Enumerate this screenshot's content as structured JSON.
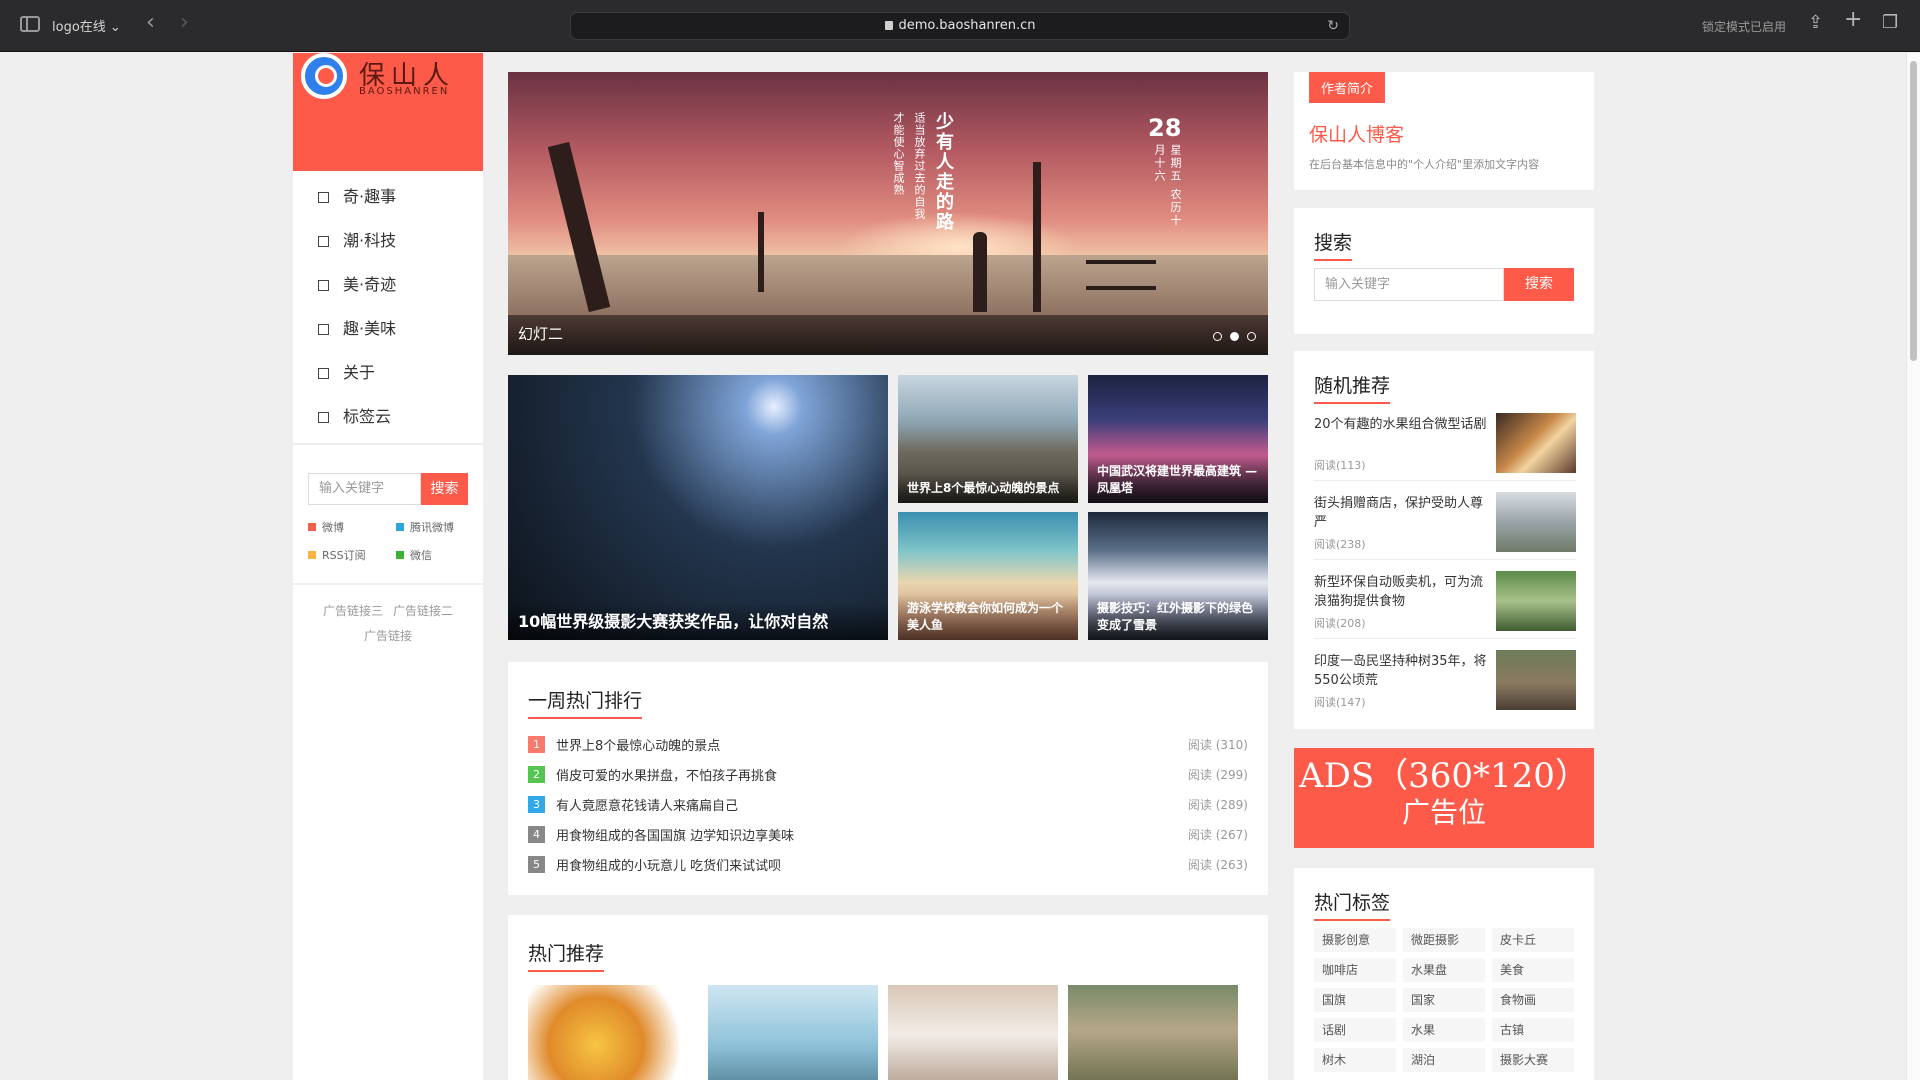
{
  "browser": {
    "tab_group": "logo在线",
    "url": "demo.baoshanren.cn",
    "lock_mode": "锁定模式已启用"
  },
  "logo": {
    "chars": "保山人",
    "en": "BAOSHANREN"
  },
  "leftnav": [
    {
      "label": "奇·趣事"
    },
    {
      "label": "潮·科技"
    },
    {
      "label": "美·奇迹"
    },
    {
      "label": "趣·美味"
    },
    {
      "label": "关于"
    },
    {
      "label": "标签云"
    }
  ],
  "left_search": {
    "placeholder": "输入关键字",
    "button": "搜索"
  },
  "social": [
    {
      "label": "微博",
      "color": "#f0624d"
    },
    {
      "label": "腾讯微博",
      "color": "#2ea7e0"
    },
    {
      "label": "RSS订阅",
      "color": "#f7b240"
    },
    {
      "label": "微信",
      "color": "#3cb034"
    }
  ],
  "left_ads": [
    "广告链接三",
    "广告链接二",
    "广告链接"
  ],
  "slider": {
    "caption": "幻灯二",
    "poem_big": "少有人走的路",
    "poem_small": "适当放弃过去的自我 才能使心智成熟",
    "day": "28",
    "date_sub": "星期五 农历十月十六",
    "dots": 3,
    "active_dot": 2
  },
  "grid": [
    {
      "caption": "10幅世界级摄影大赛获奖作品，让你对自然"
    },
    {
      "caption": "世界上8个最惊心动魄的景点"
    },
    {
      "caption": "中国武汉将建世界最高建筑 — 凤凰塔"
    },
    {
      "caption": "游泳学校教会你如何成为一个美人鱼"
    },
    {
      "caption": "摄影技巧：红外摄影下的绿色变成了雪景"
    }
  ],
  "hot_week": {
    "title": "一周热门排行",
    "items": [
      {
        "num": "1",
        "title": "世界上8个最惊心动魄的景点",
        "reads": "阅读 (310)",
        "color": "#f77a6c"
      },
      {
        "num": "2",
        "title": "俏皮可爱的水果拼盘，不怕孩子再挑食",
        "reads": "阅读 (299)",
        "color": "#54c64f"
      },
      {
        "num": "3",
        "title": "有人竟愿意花钱请人来痛扁自己",
        "reads": "阅读 (289)",
        "color": "#31a8e8"
      },
      {
        "num": "4",
        "title": "用食物组成的各国国旗 边学知识边享美味",
        "reads": "阅读 (267)",
        "color": "#888888"
      },
      {
        "num": "5",
        "title": "用食物组成的小玩意儿 吃货们来试试呗",
        "reads": "阅读 (263)",
        "color": "#888888"
      }
    ]
  },
  "hot_rec": {
    "title": "热门推荐"
  },
  "author": {
    "tag": "作者简介",
    "name": "保山人博客",
    "desc": "在后台基本信息中的\"个人介绍\"里添加文字内容"
  },
  "right_search": {
    "title": "搜索",
    "placeholder": "输入关键字",
    "button": "搜索"
  },
  "random": {
    "title": "随机推荐",
    "items": [
      {
        "title": "20个有趣的水果组合微型话剧",
        "reads": "阅读(113)"
      },
      {
        "title": "街头捐赠商店，保护受助人尊严",
        "reads": "阅读(238)"
      },
      {
        "title": "新型环保自动贩卖机，可为流浪猫狗提供食物",
        "reads": "阅读(208)"
      },
      {
        "title": "印度一岛民坚持种树35年，将550公顷荒",
        "reads": "阅读(147)"
      }
    ]
  },
  "ads": {
    "line1": "ADS（360*120）",
    "line2": "广告位"
  },
  "tags": {
    "title": "热门标签",
    "items": [
      "摄影创意",
      "微距摄影",
      "皮卡丘",
      "咖啡店",
      "水果盘",
      "美食",
      "国旗",
      "国家",
      "食物画",
      "话剧",
      "水果",
      "古镇",
      "树木",
      "湖泊",
      "摄影大赛"
    ]
  }
}
